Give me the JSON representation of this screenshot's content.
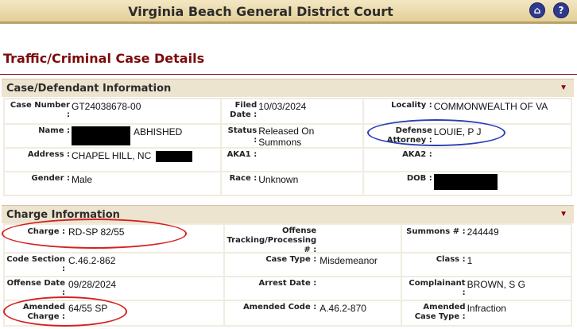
{
  "header": {
    "court_name": "Virginia Beach General District Court",
    "home_icon": "house-icon",
    "help_icon": "question-icon"
  },
  "page_title": "Traffic/Criminal Case Details",
  "case_section": {
    "title": "Case/Defendant Information",
    "fields": {
      "case_number": {
        "label": "Case Number :",
        "value": "GT24038678-00"
      },
      "filed_date": {
        "label": "Filed Date :",
        "value": "10/03/2024"
      },
      "locality": {
        "label": "Locality :",
        "value": "COMMONWEALTH OF VA"
      },
      "name": {
        "label": "Name :",
        "value": "ABHISHED"
      },
      "status": {
        "label": "Status :",
        "value": "Released On Summons"
      },
      "defense_attorney": {
        "label": "Defense Attorney :",
        "value": "LOUIE, P J"
      },
      "address": {
        "label": "Address :",
        "value": "CHAPEL HILL, NC"
      },
      "aka1": {
        "label": "AKA1 :",
        "value": ""
      },
      "aka2": {
        "label": "AKA2 :",
        "value": ""
      },
      "gender": {
        "label": "Gender :",
        "value": "Male"
      },
      "race": {
        "label": "Race :",
        "value": "Unknown"
      },
      "dob": {
        "label": "DOB :",
        "value": ""
      }
    }
  },
  "charge_section": {
    "title": "Charge Information",
    "fields": {
      "charge": {
        "label": "Charge :",
        "value": "RD-SP 82/55"
      },
      "offense_tracking": {
        "label": "Offense Tracking/Processing # :",
        "value": ""
      },
      "summons": {
        "label": "Summons # :",
        "value": "244449"
      },
      "code_section": {
        "label": "Code Section :",
        "value": "C.46.2-862"
      },
      "case_type": {
        "label": "Case Type :",
        "value": "Misdemeanor"
      },
      "class": {
        "label": "Class :",
        "value": "1"
      },
      "offense_date": {
        "label": "Offense Date :",
        "value": "09/28/2024"
      },
      "arrest_date": {
        "label": "Arrest Date :",
        "value": ""
      },
      "complainant": {
        "label": "Complainant :",
        "value": "BROWN, S G"
      },
      "amended_charge": {
        "label": "Amended Charge :",
        "value": "64/55 SP"
      },
      "amended_code": {
        "label": "Amended Code :",
        "value": "A.46.2-870"
      },
      "amended_case_type": {
        "label": "Amended Case Type :",
        "value": "Infraction"
      }
    }
  },
  "colors": {
    "accent": "#7b0b0b",
    "header_band": "#e3cf97",
    "annotation_red": "#d62020",
    "annotation_blue": "#2b3fb5"
  }
}
